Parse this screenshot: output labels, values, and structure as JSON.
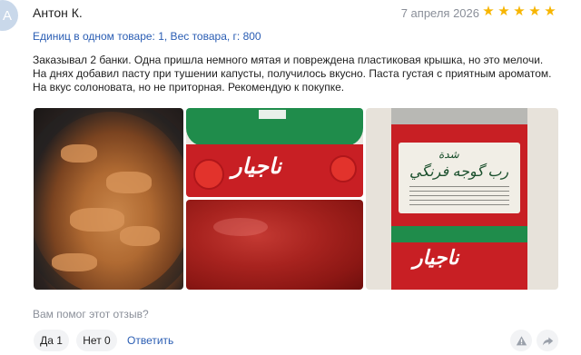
{
  "avatar": {
    "letter": "А",
    "color": "#c9d8ea"
  },
  "review": {
    "author": "Антон К.",
    "date": "7 апреля 2026",
    "rating": 5,
    "stars": [
      "★",
      "★",
      "★",
      "★",
      "★"
    ],
    "star_color": "#f7b500",
    "product_meta": "Единиц в одном товаре: 1, Вес товара, г: 800",
    "text": "Заказывал 2 банки. Одна пришла немного мятая и повреждена пластиковая крышка, но это мелочи. На днях добавил пасту при тушении капусты, получилось вкусно. Паста густая с приятным ароматом. На вкус солоновата, но не приторная. Рекомендую к покупке.",
    "photos": [
      {
        "name": "photo-stewed-cabbage"
      },
      {
        "name": "photo-tomato-paste-can-lid"
      },
      {
        "name": "photo-tomato-paste-closeup"
      },
      {
        "name": "photo-tomato-paste-can-label"
      }
    ]
  },
  "feedback": {
    "question": "Вам помог этот отзыв?",
    "yes_label": "Да 1",
    "no_label": "Нет 0",
    "reply_label": "Ответить",
    "warn_icon": "warning-icon",
    "share_icon": "share-icon"
  },
  "colors": {
    "link": "#2a5db3",
    "muted": "#8a8f99",
    "button_bg": "#f2f3f5"
  }
}
